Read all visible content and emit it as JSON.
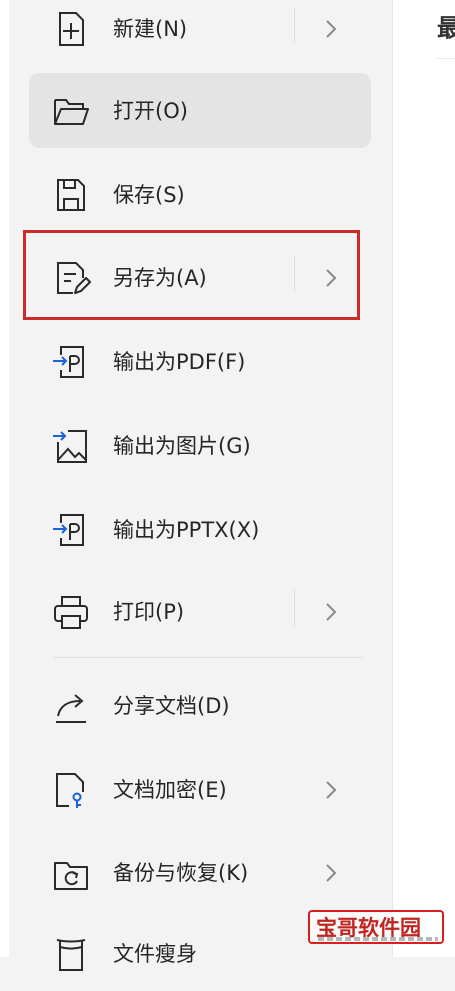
{
  "menu": {
    "items": [
      {
        "label": "新建(N)",
        "icon": "new-file-icon",
        "has_submenu": true
      },
      {
        "label": "打开(O)",
        "icon": "folder-icon",
        "has_submenu": false,
        "selected": true
      },
      {
        "label": "保存(S)",
        "icon": "save-icon",
        "has_submenu": false
      },
      {
        "label": "另存为(A)",
        "icon": "save-as-icon",
        "has_submenu": true,
        "highlighted": true
      },
      {
        "label": "输出为PDF(F)",
        "icon": "export-pdf-icon",
        "has_submenu": false
      },
      {
        "label": "输出为图片(G)",
        "icon": "export-image-icon",
        "has_submenu": false
      },
      {
        "label": "输出为PPTX(X)",
        "icon": "export-pptx-icon",
        "has_submenu": false
      },
      {
        "label": "打印(P)",
        "icon": "printer-icon",
        "has_submenu": true
      },
      {
        "label": "分享文档(D)",
        "icon": "share-icon",
        "has_submenu": false
      },
      {
        "label": "文档加密(E)",
        "icon": "encrypt-icon",
        "has_submenu": true
      },
      {
        "label": "备份与恢复(K)",
        "icon": "backup-icon",
        "has_submenu": true
      },
      {
        "label": "文件瘦身",
        "icon": "slim-icon",
        "has_submenu": false
      }
    ]
  },
  "right_panel": {
    "title": "最"
  },
  "watermark": {
    "text": "宝哥软件园"
  },
  "colors": {
    "highlight_border": "#cf2a2a",
    "selected_bg": "#e4e4e4",
    "menu_bg": "#f3f3f3"
  }
}
